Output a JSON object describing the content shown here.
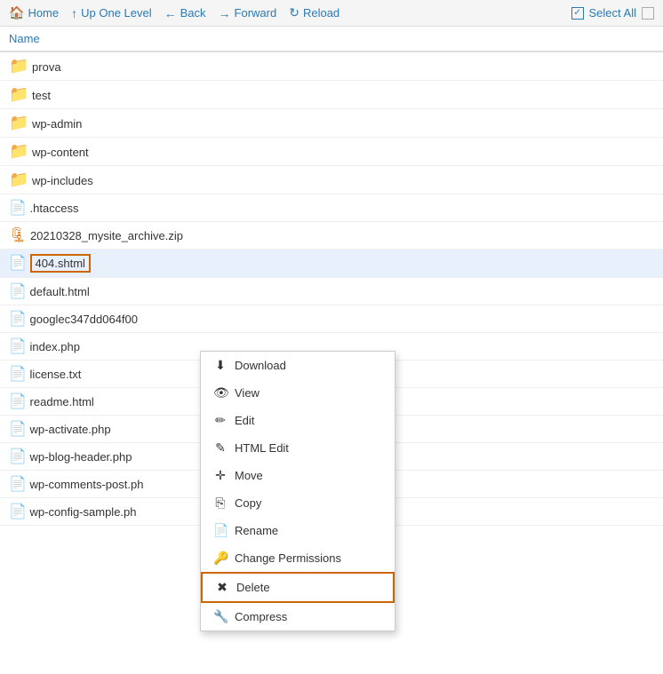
{
  "toolbar": {
    "home_label": "Home",
    "up_one_level_label": "Up One Level",
    "back_label": "Back",
    "forward_label": "Forward",
    "reload_label": "Reload",
    "select_all_label": "Select All"
  },
  "columns": {
    "name": "Name"
  },
  "files": [
    {
      "name": "prova",
      "type": "folder"
    },
    {
      "name": "test",
      "type": "folder"
    },
    {
      "name": "wp-admin",
      "type": "folder"
    },
    {
      "name": "wp-content",
      "type": "folder"
    },
    {
      "name": "wp-includes",
      "type": "folder"
    },
    {
      "name": ".htaccess",
      "type": "doc"
    },
    {
      "name": "20210328_mysite_archive.zip",
      "type": "zip"
    },
    {
      "name": "404.shtml",
      "type": "html",
      "selected": true
    },
    {
      "name": "default.html",
      "type": "html"
    },
    {
      "name": "googlec347dd064f00",
      "type": "html"
    },
    {
      "name": "index.php",
      "type": "php"
    },
    {
      "name": "license.txt",
      "type": "doc"
    },
    {
      "name": "readme.html",
      "type": "html"
    },
    {
      "name": "wp-activate.php",
      "type": "php"
    },
    {
      "name": "wp-blog-header.php",
      "type": "php"
    },
    {
      "name": "wp-comments-post.ph",
      "type": "php"
    },
    {
      "name": "wp-config-sample.ph",
      "type": "php"
    }
  ],
  "context_menu": {
    "items": [
      {
        "label": "Download",
        "icon": "⬇"
      },
      {
        "label": "View",
        "icon": "👁"
      },
      {
        "label": "Edit",
        "icon": "✏"
      },
      {
        "label": "HTML Edit",
        "icon": "✎"
      },
      {
        "label": "Move",
        "icon": "✛"
      },
      {
        "label": "Copy",
        "icon": "⎘"
      },
      {
        "label": "Rename",
        "icon": "📄"
      },
      {
        "label": "Change Permissions",
        "icon": "🔑"
      },
      {
        "label": "Delete",
        "icon": "✖",
        "highlight": true
      },
      {
        "label": "Compress",
        "icon": "🔧"
      }
    ]
  }
}
